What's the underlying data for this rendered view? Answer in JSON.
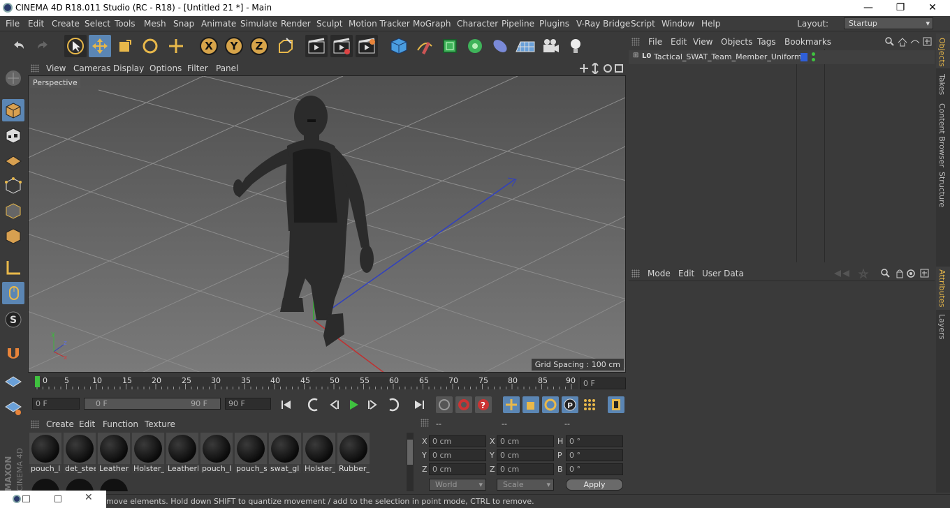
{
  "window": {
    "title": "CINEMA 4D R18.011 Studio (RC - R18) - [Untitled 21 *] - Main",
    "minimize": "—",
    "restore": "❐",
    "close": "✕"
  },
  "menu": [
    "File",
    "Edit",
    "Create",
    "Select",
    "Tools",
    "Mesh",
    "Snap",
    "Animate",
    "Simulate",
    "Render",
    "Sculpt",
    "Motion Tracker",
    "MoGraph",
    "Character",
    "Pipeline",
    "Plugins",
    "V-Ray Bridge",
    "Script",
    "Window",
    "Help"
  ],
  "layout": {
    "label": "Layout:",
    "value": "Startup"
  },
  "toolbar": {
    "x_label": "X",
    "y_label": "Y",
    "z_label": "Z"
  },
  "viewport": {
    "menu": [
      "View",
      "Cameras",
      "Display",
      "Options",
      "Filter",
      "Panel"
    ],
    "label": "Perspective",
    "grid_spacing": "Grid Spacing : 100 cm"
  },
  "timeline": {
    "ticks": [
      "0",
      "5",
      "10",
      "15",
      "20",
      "25",
      "30",
      "35",
      "40",
      "45",
      "50",
      "55",
      "60",
      "65",
      "70",
      "75",
      "80",
      "85",
      "90"
    ],
    "current_frame": "0 F"
  },
  "playback": {
    "start": "0 F",
    "range_start": "0 F",
    "range_end": "90 F",
    "end": "90 F"
  },
  "materials": {
    "menu": [
      "Create",
      "Edit",
      "Function",
      "Texture"
    ],
    "items": [
      "pouch_l",
      "det_stee",
      "Leather",
      "Holster_",
      "Leatherl",
      "pouch_l",
      "pouch_s",
      "swat_gl",
      "Holster_",
      "Rubber_"
    ]
  },
  "coords": {
    "headers": [
      "--",
      "--",
      "--"
    ],
    "rows": [
      {
        "a": "X",
        "av": "0 cm",
        "b": "X",
        "bv": "0 cm",
        "c": "H",
        "cv": "0 °"
      },
      {
        "a": "Y",
        "av": "0 cm",
        "b": "Y",
        "bv": "0 cm",
        "c": "P",
        "cv": "0 °"
      },
      {
        "a": "Z",
        "av": "0 cm",
        "b": "Z",
        "bv": "0 cm",
        "c": "B",
        "cv": "0 °"
      }
    ],
    "world": "World",
    "scale": "Scale",
    "apply": "Apply"
  },
  "objects": {
    "menu": [
      "File",
      "Edit",
      "View",
      "Objects",
      "Tags",
      "Bookmarks"
    ],
    "items": [
      {
        "name": "Tactical_SWAT_Team_Member_Uniform",
        "tag_color": "#2f5fd8"
      }
    ]
  },
  "attributes": {
    "menu": [
      "Mode",
      "Edit",
      "User Data"
    ]
  },
  "right_tabs": {
    "top": [
      "Objects",
      "Takes",
      "Content Browser",
      "Structure"
    ],
    "bottom": [
      "Attributes",
      "Layers"
    ]
  },
  "status": "move elements. Hold down SHIFT to quantize movement / add to the selection in point mode, CTRL to remove.",
  "logo": {
    "text1": "MAXON",
    "text2": "CINEMA 4D"
  },
  "colors": {
    "accent": "#5b86b4",
    "highlight": "#e8b84a",
    "play_green": "#3fc23f"
  }
}
